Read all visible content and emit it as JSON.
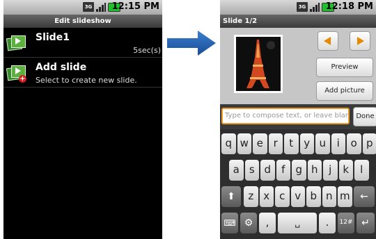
{
  "left_screen": {
    "status_time": "12:15 PM",
    "network_label": "3G",
    "title": "Edit slideshow",
    "items": [
      {
        "title": "Slide1",
        "subtitle": "",
        "duration": "5sec(s)"
      },
      {
        "title": "Add slide",
        "subtitle": "Select to create new slide.",
        "duration": ""
      }
    ]
  },
  "right_screen": {
    "status_time": "12:18 PM",
    "network_label": "3G",
    "title": "Slide 1/2",
    "preview_label": "Preview",
    "add_picture_label": "Add picture",
    "compose_placeholder": "Type to compose text, or leave blank",
    "done_label": "Done",
    "keyboard": {
      "row1": [
        "q",
        "w",
        "e",
        "r",
        "t",
        "y",
        "u",
        "i",
        "o",
        "p"
      ],
      "row2": [
        "a",
        "s",
        "d",
        "f",
        "g",
        "h",
        "j",
        "k",
        "l"
      ],
      "row3": [
        "z",
        "x",
        "c",
        "v",
        "b",
        "n",
        "m"
      ],
      "comma": ",",
      "period": ".",
      "sym_label": "12#"
    }
  },
  "colors": {
    "accent_orange": "#e58a00",
    "arrow_blue": "#1f5fa8",
    "battery_green": "#1fbf2a"
  },
  "icons": [
    "slide-icon",
    "add-slide-icon",
    "prev-arrow-icon",
    "next-arrow-icon",
    "shift-icon",
    "backspace-icon",
    "enter-icon",
    "keyboard-icon",
    "gear-icon",
    "space-icon"
  ]
}
